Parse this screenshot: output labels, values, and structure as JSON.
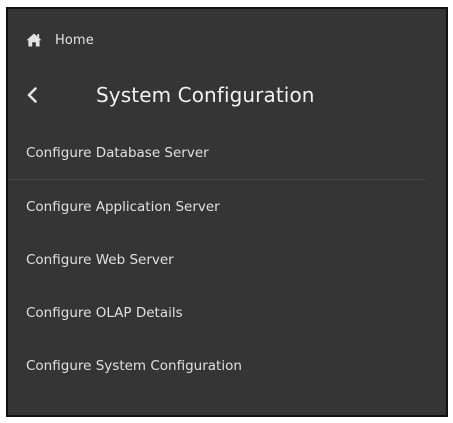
{
  "nav": {
    "home_label": "Home",
    "home_icon": "home-icon",
    "back_icon": "chevron-left-icon"
  },
  "header": {
    "title": "System Configuration"
  },
  "menu": {
    "items": [
      {
        "label": "Configure Database Server"
      },
      {
        "label": "Configure Application Server"
      },
      {
        "label": "Configure Web Server"
      },
      {
        "label": "Configure OLAP Details"
      },
      {
        "label": "Configure System Configuration"
      }
    ]
  },
  "colors": {
    "panel_bg": "#353535",
    "text": "#e0e0e0",
    "divider": "#454545"
  }
}
